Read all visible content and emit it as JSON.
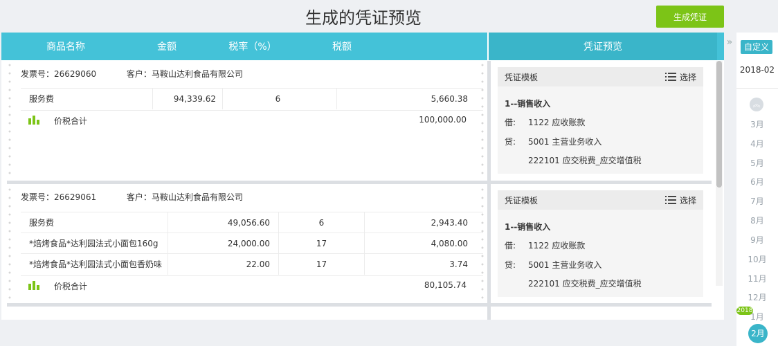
{
  "title": "生成的凭证预览",
  "generate_button": "生成凭证",
  "columns": {
    "name": "商品名称",
    "amount": "金额",
    "rate": "税率（%）",
    "tax": "税额",
    "preview": "凭证预览"
  },
  "invoices": [
    {
      "invoice_label": "发票号：",
      "invoice_no": "26629060",
      "customer_label": "客户：",
      "customer": "马鞍山达利食品有限公司",
      "rows": [
        {
          "name": "服务费",
          "amount": "94,339.62",
          "rate": "6",
          "tax": "5,660.38"
        }
      ],
      "total_label": "价税合计",
      "total": "100,000.00"
    },
    {
      "invoice_label": "发票号：",
      "invoice_no": "26629061",
      "customer_label": "客户：",
      "customer": "马鞍山达利食品有限公司",
      "rows": [
        {
          "name": "服务费",
          "amount": "49,056.60",
          "rate": "6",
          "tax": "2,943.40"
        },
        {
          "name": "*焙烤食品*达利园法式小面包160g",
          "amount": "24,000.00",
          "rate": "17",
          "tax": "4,080.00"
        },
        {
          "name": "*焙烤食品*达利园法式小面包香奶味",
          "amount": "22.00",
          "rate": "17",
          "tax": "3.74"
        }
      ],
      "total_label": "价税合计",
      "total": "80,105.74"
    }
  ],
  "vouchers": [
    {
      "template_label": "凭证模板",
      "select_label": "选择",
      "name": "1--销售收入",
      "debit_label": "借:",
      "debit": "1122 应收账款",
      "credit_label": "贷:",
      "credit1": "5001 主营业务收入",
      "credit2": "222101 应交税费_应交增值税"
    },
    {
      "template_label": "凭证模板",
      "select_label": "选择",
      "name": "1--销售收入",
      "debit_label": "借:",
      "debit": "1122 应收账款",
      "credit_label": "贷:",
      "credit1": "5001 主营业务收入",
      "credit2": "222101 应交税费_应交增值税"
    }
  ],
  "sidebar": {
    "expand_icon": "»",
    "custom": "自定义",
    "period": "2018-02",
    "months": [
      "3月",
      "4月",
      "5月",
      "6月",
      "7月",
      "8月",
      "9月",
      "10月",
      "11月",
      "12月",
      "1月"
    ],
    "year_badge": "2018",
    "current": "2月"
  },
  "colors": {
    "header": "#44c2d8",
    "accent": "#3ab5c9",
    "green": "#7cc417"
  }
}
